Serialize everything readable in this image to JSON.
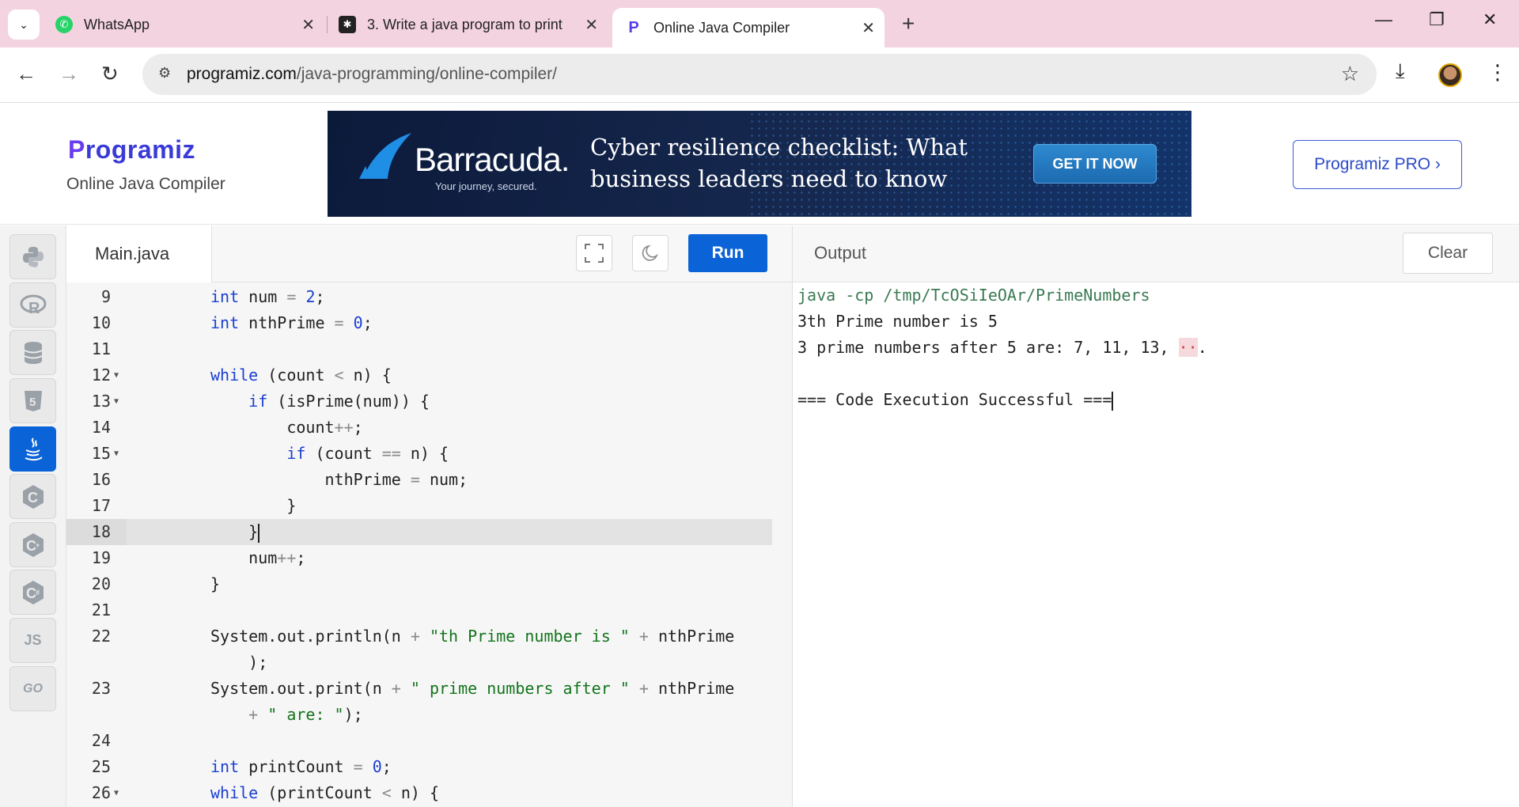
{
  "browser": {
    "tabs": [
      {
        "title": "WhatsApp",
        "icon": "whatsapp-icon"
      },
      {
        "title": "3. Write a java program to print",
        "icon": "app-icon"
      },
      {
        "title": "Online Java Compiler",
        "icon": "programiz-icon"
      }
    ],
    "url_domain": "programiz.com",
    "url_path": "/java-programming/online-compiler/"
  },
  "site": {
    "logo": "rogramiz",
    "logo_p": "P",
    "subtitle": "Online Java Compiler",
    "pro_button": "Programiz PRO ›"
  },
  "ad": {
    "brand": "Barracuda.",
    "tagline": "Your journey, secured.",
    "headline": "Cyber resilience checklist: What business leaders need to know",
    "cta": "GET IT NOW"
  },
  "sidebar": {
    "languages": [
      "python",
      "r",
      "sql",
      "html",
      "java",
      "c",
      "cpp",
      "csharp",
      "js",
      "go"
    ],
    "js_label": "JS",
    "go_label": "GO"
  },
  "editor": {
    "file_name": "Main.java",
    "run_label": "Run",
    "active_line": 18,
    "lines": [
      {
        "n": "9",
        "fold": false,
        "code": "int num = 2;"
      },
      {
        "n": "10",
        "fold": false,
        "code": "int nthPrime = 0;"
      },
      {
        "n": "11",
        "fold": false,
        "code": ""
      },
      {
        "n": "12",
        "fold": true,
        "code": "while (count < n) {"
      },
      {
        "n": "13",
        "fold": true,
        "code": "    if (isPrime(num)) {"
      },
      {
        "n": "14",
        "fold": false,
        "code": "        count++;"
      },
      {
        "n": "15",
        "fold": true,
        "code": "        if (count == n) {"
      },
      {
        "n": "16",
        "fold": false,
        "code": "            nthPrime = num;"
      },
      {
        "n": "17",
        "fold": false,
        "code": "        }"
      },
      {
        "n": "18",
        "fold": false,
        "code": "    }"
      },
      {
        "n": "19",
        "fold": false,
        "code": "    num++;"
      },
      {
        "n": "20",
        "fold": false,
        "code": "}"
      },
      {
        "n": "21",
        "fold": false,
        "code": ""
      },
      {
        "n": "22",
        "fold": false,
        "code": "System.out.println(n + \"th Prime number is \" + nthPrime"
      },
      {
        "n": "",
        "fold": false,
        "code": "    );"
      },
      {
        "n": "23",
        "fold": false,
        "code": "System.out.print(n + \" prime numbers after \" + nthPrime"
      },
      {
        "n": "",
        "fold": false,
        "code": "    + \" are: \");"
      },
      {
        "n": "24",
        "fold": false,
        "code": ""
      },
      {
        "n": "25",
        "fold": false,
        "code": "int printCount = 0;"
      },
      {
        "n": "26",
        "fold": true,
        "code": "while (printCount < n) {"
      }
    ]
  },
  "output": {
    "label": "Output",
    "clear_label": "Clear",
    "lines": [
      "java -cp /tmp/TcOSiIeOAr/PrimeNumbers",
      "3th Prime number is 5",
      "3 prime numbers after 5 are: 7, 11, 13, ",
      "",
      "=== Code Execution Successful ==="
    ],
    "ellipsis": "··",
    "period": "."
  }
}
